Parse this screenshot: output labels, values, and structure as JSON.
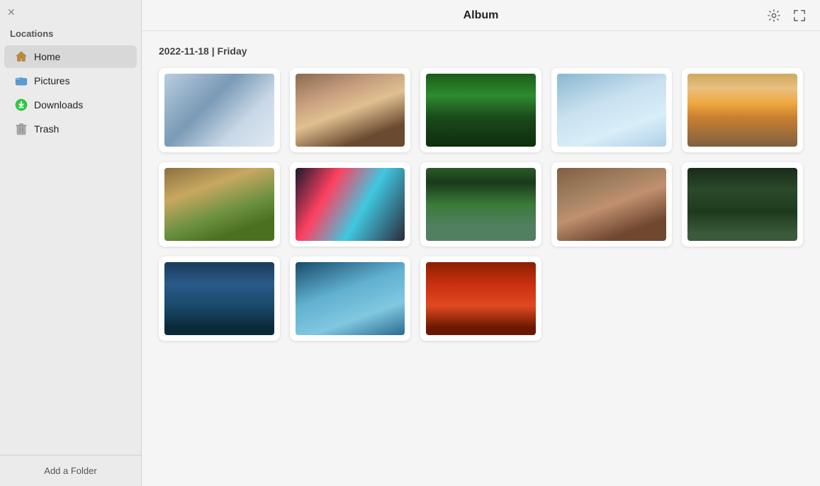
{
  "sidebar": {
    "section_label": "Locations",
    "items": [
      {
        "id": "home",
        "label": "Home",
        "active": true
      },
      {
        "id": "pictures",
        "label": "Pictures",
        "active": false
      },
      {
        "id": "downloads",
        "label": "Downloads",
        "active": false
      },
      {
        "id": "trash",
        "label": "Trash",
        "active": false
      }
    ],
    "add_folder": "Add a Folder"
  },
  "toolbar": {
    "title": "Album",
    "settings_icon": "⚙",
    "fullscreen_icon": "⛶"
  },
  "content": {
    "date_label": "2022-11-18 | Friday",
    "photos": [
      {
        "id": 1,
        "style_class": "photo-1"
      },
      {
        "id": 2,
        "style_class": "photo-2"
      },
      {
        "id": 3,
        "style_class": "photo-3"
      },
      {
        "id": 4,
        "style_class": "photo-4"
      },
      {
        "id": 5,
        "style_class": "photo-5"
      },
      {
        "id": 6,
        "style_class": "photo-6"
      },
      {
        "id": 7,
        "style_class": "photo-7"
      },
      {
        "id": 8,
        "style_class": "photo-8"
      },
      {
        "id": 9,
        "style_class": "photo-9"
      },
      {
        "id": 10,
        "style_class": "photo-10"
      },
      {
        "id": 11,
        "style_class": "photo-11"
      },
      {
        "id": 12,
        "style_class": "photo-12"
      },
      {
        "id": 13,
        "style_class": "photo-13"
      }
    ]
  }
}
